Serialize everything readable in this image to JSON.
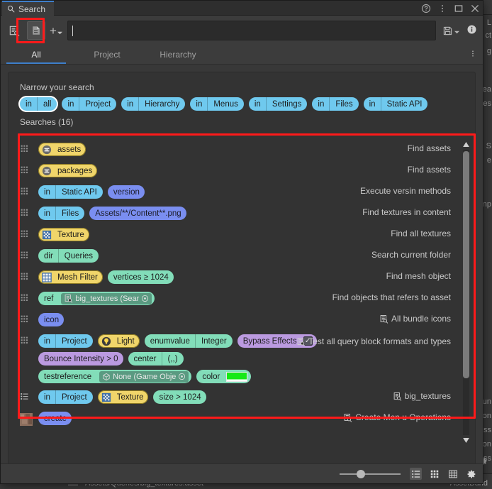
{
  "window": {
    "tab_title": "Search",
    "tab_icon": "magnifier-icon",
    "controls": [
      "help-icon",
      "kebab-menu-icon",
      "maximize-icon",
      "close-icon"
    ]
  },
  "toolbar": {
    "left_icons": [
      "saved-searches-icon",
      "search-provider-icon"
    ],
    "add_filter_label": "+",
    "search_value": "",
    "search_placeholder": "",
    "right_icons": [
      "save-query-icon",
      "save-dropdown-icon",
      "info-icon"
    ]
  },
  "provider_tabs": [
    {
      "label": "All",
      "active": true
    },
    {
      "label": "Project",
      "active": false
    },
    {
      "label": "Hierarchy",
      "active": false
    }
  ],
  "panel": {
    "narrow_title": "Narrow your search",
    "narrow_chips": [
      {
        "key": "in",
        "value": "all",
        "focused": true
      },
      {
        "key": "in",
        "value": "Project",
        "focused": false
      },
      {
        "key": "in",
        "value": "Hierarchy",
        "focused": false
      },
      {
        "key": "in",
        "value": "Menus",
        "focused": false
      },
      {
        "key": "in",
        "value": "Settings",
        "focused": false
      },
      {
        "key": "in",
        "value": "Files",
        "focused": false
      },
      {
        "key": "in",
        "value": "Static API",
        "focused": false
      }
    ],
    "searches_title": "Searches (16)",
    "rows": [
      {
        "lead": "grid-dots-icon",
        "desc": "Find assets",
        "desc_icon": "",
        "blocks": [
          {
            "style": "outlined-yellow",
            "badge": "asset-db-icon",
            "segs": [
              "assets"
            ]
          }
        ]
      },
      {
        "lead": "grid-dots-icon",
        "desc": "Find assets",
        "desc_icon": "",
        "blocks": [
          {
            "style": "outlined-yellow",
            "badge": "asset-db-icon",
            "segs": [
              "packages"
            ]
          }
        ]
      },
      {
        "lead": "grid-dots-icon",
        "desc": "Execute versin methods",
        "desc_icon": "",
        "blocks": [
          {
            "style": "blue",
            "segs": [
              "in",
              "Static API"
            ]
          },
          {
            "style": "blue2",
            "segs": [
              "version"
            ]
          }
        ]
      },
      {
        "lead": "grid-dots-icon",
        "desc": "Find textures in content",
        "desc_icon": "",
        "blocks": [
          {
            "style": "blue",
            "segs": [
              "in",
              "Files"
            ]
          },
          {
            "style": "blue2",
            "segs": [
              "Assets/**/Content**.png"
            ]
          }
        ]
      },
      {
        "lead": "grid-dots-icon",
        "desc": "Find all textures",
        "desc_icon": "",
        "blocks": [
          {
            "style": "outlined-yellow",
            "badge": "texture-icon",
            "segs": [
              "Texture"
            ]
          }
        ]
      },
      {
        "lead": "grid-dots-icon",
        "desc": "Search current folder",
        "desc_icon": "",
        "blocks": [
          {
            "style": "green",
            "segs": [
              "dir",
              "Queries"
            ]
          }
        ]
      },
      {
        "lead": "grid-dots-icon",
        "desc": "Find mesh object",
        "desc_icon": "",
        "blocks": [
          {
            "style": "outlined-yellow",
            "badge": "mesh-filter-icon",
            "segs": [
              "Mesh Filter"
            ]
          },
          {
            "style": "green",
            "segs": [
              "vertices ≥ 1024"
            ]
          }
        ]
      },
      {
        "lead": "grid-dots-icon",
        "desc": "Find objects that refers to asset",
        "desc_icon": "",
        "blocks": [
          {
            "style": "green",
            "segs": [
              "ref"
            ],
            "object": "big_textures (Sear",
            "object_icon": "query-asset-icon"
          }
        ]
      },
      {
        "lead": "grid-dots-icon",
        "desc": "All bundle icons",
        "desc_icon": "query-asset-icon",
        "blocks": [
          {
            "style": "blue2",
            "segs": [
              "icon"
            ]
          }
        ]
      },
      {
        "lead": "grid-dots-icon",
        "desc": "Test all query block formats and types",
        "desc_icon": "query-asset-icon",
        "tall": true,
        "blocks": [
          {
            "style": "blue",
            "segs": [
              "in",
              "Project"
            ]
          },
          {
            "style": "outlined-yellow",
            "badge": "light-icon",
            "segs": [
              "Light"
            ]
          },
          {
            "style": "green",
            "segs": [
              "enumvalue",
              "Integer"
            ]
          },
          {
            "style": "purple",
            "segs": [
              "Bypass Effects"
            ],
            "checkbox": true
          },
          {
            "style": "purple",
            "segs": [
              "Bounce Intensity  >  0"
            ]
          },
          {
            "style": "green",
            "segs": [
              "center",
              "(,,)"
            ]
          },
          {
            "style": "green",
            "segs": [
              "testreference"
            ],
            "object": "None (Game Obje",
            "object_icon": "gameobject-icon"
          },
          {
            "style": "green",
            "segs": [
              "color"
            ],
            "swatch": "#16e916"
          }
        ]
      },
      {
        "lead": "list-icon",
        "desc": "big_textures",
        "desc_icon": "query-asset-icon",
        "blocks": [
          {
            "style": "blue",
            "segs": [
              "in",
              "Project"
            ]
          },
          {
            "style": "outlined-yellow",
            "badge": "texture-icon",
            "segs": [
              "Texture"
            ]
          },
          {
            "style": "green",
            "segs": [
              "size > 1024"
            ]
          }
        ]
      },
      {
        "lead": "thumbnail-icon",
        "desc": "Create Men u Operations",
        "desc_icon": "query-asset-icon",
        "blocks": [
          {
            "style": "blue2",
            "segs": [
              "create"
            ]
          }
        ]
      }
    ]
  },
  "statusbar": {
    "zoom_value": 28,
    "view_buttons": [
      {
        "icon": "list-view-icon",
        "active": true
      },
      {
        "icon": "grid-view-icon",
        "active": false
      },
      {
        "icon": "table-view-icon",
        "active": false
      }
    ],
    "settings_icon": "gear-icon"
  },
  "backdrop": {
    "columns": [
      "L",
      "ct",
      "g",
      "ea",
      "es",
      "S",
      "e",
      "np",
      "un",
      "on",
      "ss",
      "on",
      "ss"
    ],
    "bottom_label": "Assets/Queries/big_textures.asset",
    "bottom_right_label": "AssetBund"
  },
  "colors": {
    "accent_blue": "#3e7fcb",
    "pill_blue": "#6fc9ee",
    "pill_indigo": "#7a8ef0",
    "pill_yellow": "#f0d56a",
    "pill_green": "#82ddb9",
    "pill_purple": "#bb9ae0",
    "annotation_red": "#ff1a1a",
    "color_swatch": "#16e916",
    "window_bg": "#383838",
    "panel_bg": "#333333"
  }
}
